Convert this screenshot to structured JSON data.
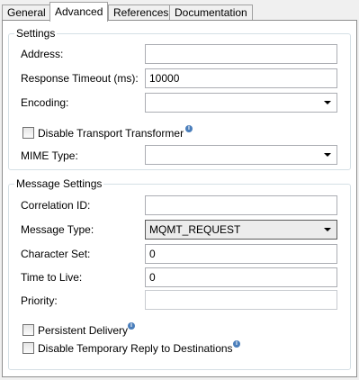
{
  "tabs": [
    "General",
    "Advanced",
    "References",
    "Documentation"
  ],
  "settings": {
    "title": "Settings",
    "address": {
      "label": "Address:",
      "value": ""
    },
    "response_timeout": {
      "label": "Response Timeout (ms):",
      "value": "10000"
    },
    "encoding": {
      "label": "Encoding:",
      "value": ""
    },
    "disable_transport_transformer": {
      "label": "Disable Transport Transformer",
      "checked": false
    },
    "mime_type": {
      "label": "MIME Type:",
      "value": ""
    }
  },
  "message_settings": {
    "title": "Message Settings",
    "correlation_id": {
      "label": "Correlation ID:",
      "value": ""
    },
    "message_type": {
      "label": "Message Type:",
      "value": "MQMT_REQUEST"
    },
    "character_set": {
      "label": "Character Set:",
      "value": "0"
    },
    "time_to_live": {
      "label": "Time to Live:",
      "value": "0"
    },
    "priority": {
      "label": "Priority:",
      "value": ""
    },
    "persistent_delivery": {
      "label": "Persistent Delivery",
      "checked": false
    },
    "disable_temp_reply": {
      "label": "Disable Temporary Reply to Destinations",
      "checked": false
    }
  },
  "icons": {
    "info": "info-icon",
    "dropdown": "chevron-down-icon"
  }
}
